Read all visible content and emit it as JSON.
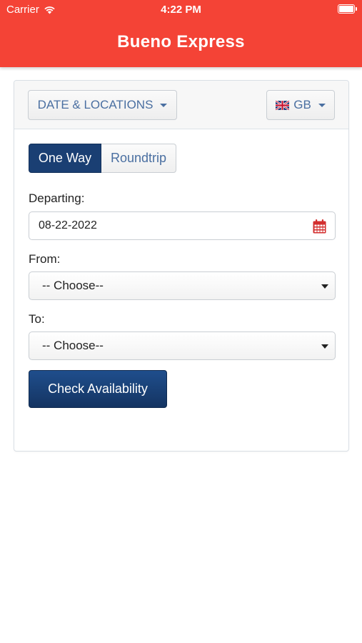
{
  "status_bar": {
    "carrier": "Carrier",
    "time": "4:22 PM"
  },
  "header": {
    "title": "Bueno Express"
  },
  "toolbar": {
    "date_locations_label": "DATE & LOCATIONS",
    "language_label": "GB"
  },
  "trip_type": {
    "one_way_label": "One Way",
    "roundtrip_label": "Roundtrip",
    "selected": "One Way"
  },
  "form": {
    "departing_label": "Departing:",
    "departing_value": "08-22-2022",
    "from_label": "From:",
    "from_value": "-- Choose--",
    "to_label": "To:",
    "to_value": "-- Choose--",
    "submit_label": "Check Availability"
  },
  "colors": {
    "header_bg": "#f44336",
    "primary": "#1a3f73",
    "link": "#4a6fa1",
    "calendar_icon": "#d32f2f"
  }
}
